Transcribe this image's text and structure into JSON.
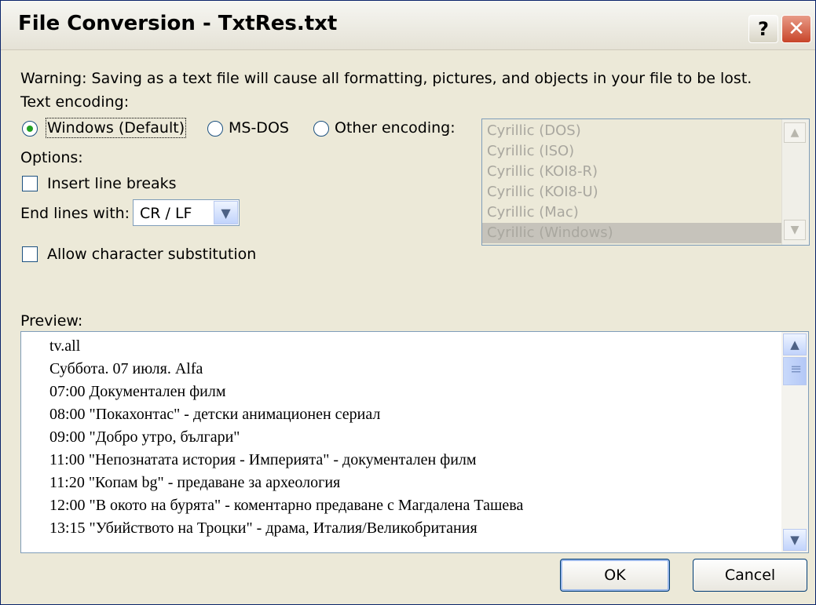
{
  "window": {
    "title": "File Conversion - TxtRes.txt",
    "help_glyph": "?",
    "close_glyph": "✕"
  },
  "warning": "Warning: Saving as a text file will cause all formatting, pictures, and objects in your file to be lost.",
  "encoding": {
    "label": "Text encoding:",
    "options": [
      {
        "label": "Windows (Default)",
        "selected": true
      },
      {
        "label": "MS-DOS",
        "selected": false
      },
      {
        "label": "Other encoding:",
        "selected": false
      }
    ],
    "list": [
      "Cyrillic (DOS)",
      "Cyrillic (ISO)",
      "Cyrillic (KOI8-R)",
      "Cyrillic (KOI8-U)",
      "Cyrillic (Mac)",
      "Cyrillic (Windows)"
    ],
    "list_selected": "Cyrillic (Windows)"
  },
  "options": {
    "label": "Options:",
    "insert_line_breaks": {
      "label": "Insert line breaks",
      "checked": false
    },
    "end_lines_with": {
      "label": "End lines with:",
      "value": "CR / LF"
    },
    "allow_char_sub": {
      "label": "Allow character substitution",
      "checked": false
    }
  },
  "preview": {
    "label": "Preview:",
    "lines": [
      "tv.all",
      "Суббота. 07 июля. Alfa",
      "07:00 Документален филм",
      "08:00 \"Покахонтас\" - детски анимационен сериал",
      "09:00 \"Добро утро, българи\"",
      "11:00 \"Непознатата история - Империята\" - документален филм",
      "11:20 \"Копам bg\" - предаване за археология",
      "12:00 \"В окото на бурята\" - коментарно предаване с Магдалена Ташева",
      "13:15 \"Убийството на Троцки\" - драма, Италия/Великобритания"
    ]
  },
  "buttons": {
    "ok": "OK",
    "cancel": "Cancel"
  },
  "colors": {
    "title_bar": "#f6f6f2",
    "dialog_bg": "#ece9d8",
    "radio_dot": "#21a121",
    "close_btn": "#c8452a"
  }
}
